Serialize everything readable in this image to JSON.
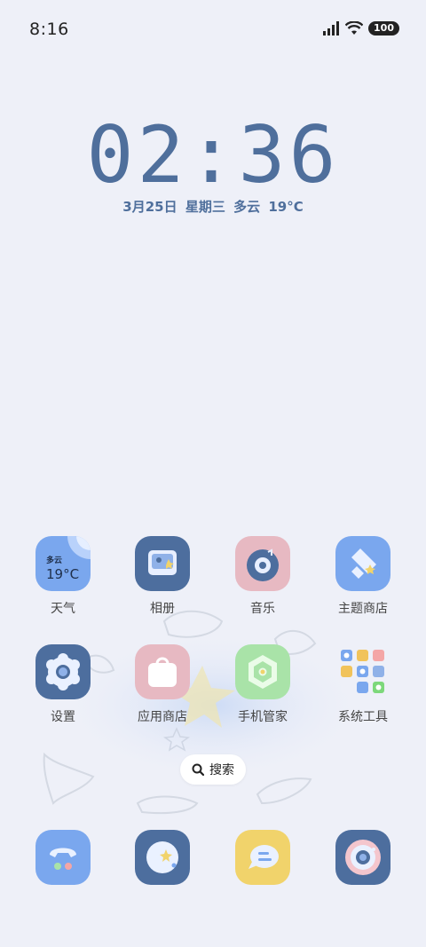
{
  "status_bar": {
    "time": "8:16",
    "battery": "100"
  },
  "clock": {
    "time": "02:36",
    "date": "3月25日",
    "weekday": "星期三",
    "weather": "多云",
    "temp": "19°C"
  },
  "apps": [
    {
      "name": "天气",
      "icon": "weather-icon"
    },
    {
      "name": "相册",
      "icon": "gallery-icon"
    },
    {
      "name": "音乐",
      "icon": "music-icon"
    },
    {
      "name": "主题商店",
      "icon": "theme-store-icon"
    },
    {
      "name": "设置",
      "icon": "settings-icon"
    },
    {
      "name": "应用商店",
      "icon": "app-store-icon"
    },
    {
      "name": "手机管家",
      "icon": "security-icon"
    },
    {
      "name": "系统工具",
      "icon": "system-tools-folder-icon"
    }
  ],
  "weather_widget": {
    "condition": "多云",
    "temp": "19°C"
  },
  "search": {
    "label": "搜索"
  },
  "dock": [
    {
      "icon": "phone-icon"
    },
    {
      "icon": "browser-icon"
    },
    {
      "icon": "messages-icon"
    },
    {
      "icon": "camera-icon"
    }
  ],
  "colors": {
    "accent": "#4f6f9c",
    "background": "#eef0f8"
  }
}
